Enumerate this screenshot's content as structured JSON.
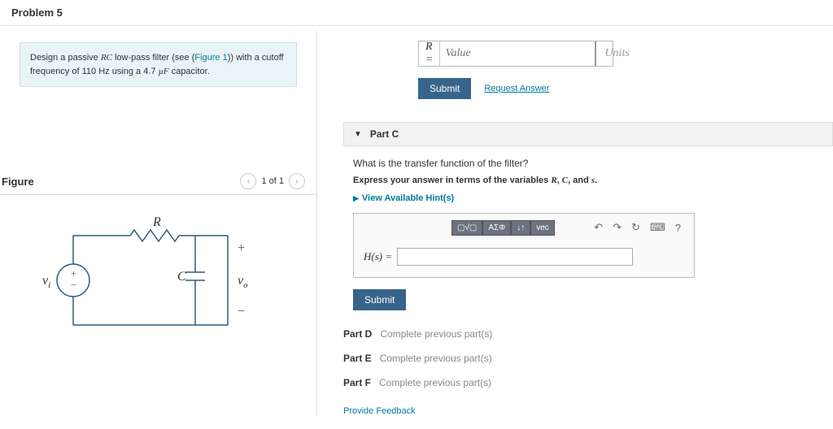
{
  "problem": {
    "title": "Problem 5"
  },
  "prompt": {
    "text_before": "Design a passive ",
    "rc": "RC",
    "text_mid1": " low-pass filter (see (",
    "figure_link": "Figure 1",
    "text_mid2": ")) with a cutoff frequency of 110 ",
    "hz": "Hz",
    "text_mid3": " using a 4.7 ",
    "uf": "µF",
    "text_end": " capacitor."
  },
  "figure": {
    "title": "Figure",
    "pager": "1 of 1",
    "labels": {
      "R": "R",
      "C": "C",
      "vi": "v",
      "vi_sub": "i",
      "vo": "v",
      "vo_sub": "o"
    }
  },
  "answerA": {
    "label": "R =",
    "value_placeholder": "Value",
    "units_placeholder": "Units",
    "submit": "Submit",
    "request": "Request Answer"
  },
  "partC": {
    "header": "Part C",
    "question": "What is the transfer function of the filter?",
    "instruction_before": "Express your answer in terms of the variables ",
    "instr_r": "R",
    "instr_c1": ", ",
    "instr_c": "C",
    "instr_c2": ", and ",
    "instr_s": "s",
    "instr_end": ".",
    "hints": "View Available Hint(s)",
    "toolbar": {
      "t1": "▢√▢",
      "t2": "ΑΣΦ",
      "t3": "↓↑",
      "t4": "vec"
    },
    "hs": "H(s) =",
    "submit": "Submit"
  },
  "locked": {
    "d": {
      "label": "Part D",
      "msg": "Complete previous part(s)"
    },
    "e": {
      "label": "Part E",
      "msg": "Complete previous part(s)"
    },
    "f": {
      "label": "Part F",
      "msg": "Complete previous part(s)"
    }
  },
  "feedback": "Provide Feedback"
}
